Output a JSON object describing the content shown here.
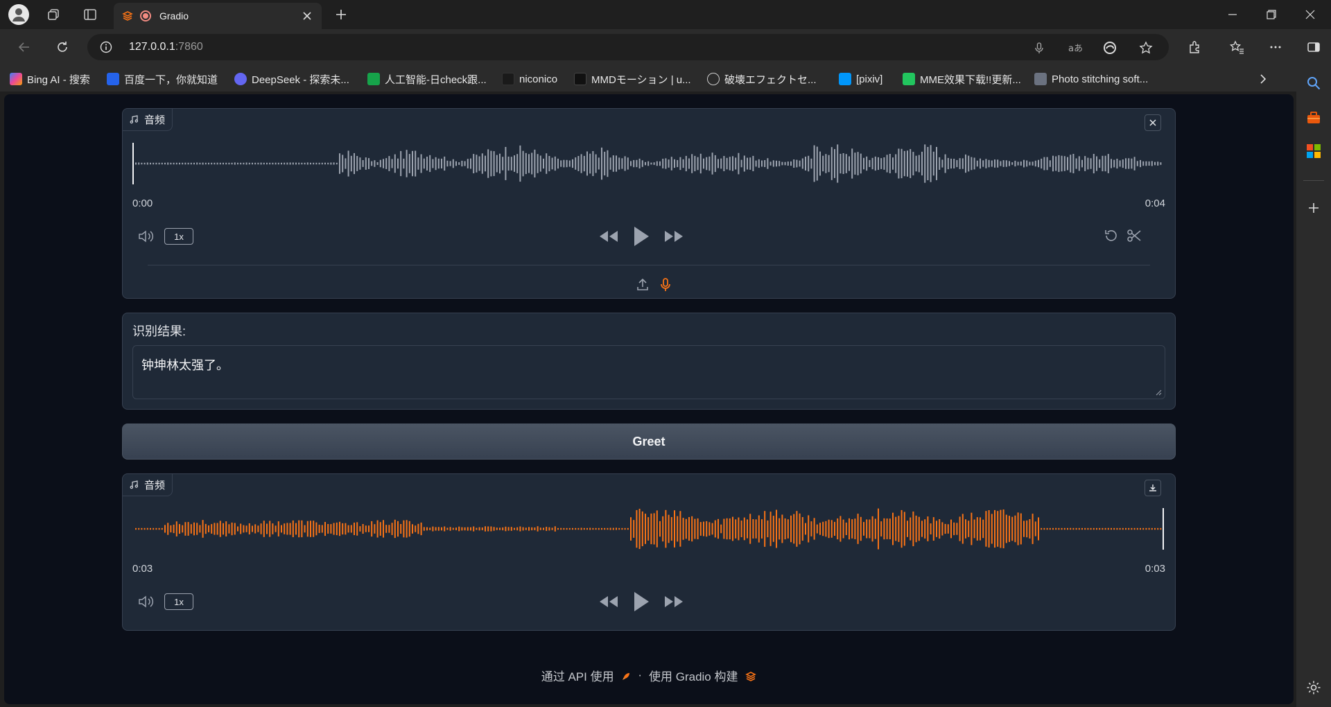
{
  "browser": {
    "tab": {
      "title": "Gradio"
    },
    "address": {
      "host": "127.0.0.1",
      "port": ":7860"
    },
    "bookmarks": [
      {
        "label": "Bing AI - 搜索",
        "color": "#3b82f6"
      },
      {
        "label": "百度一下，你就知道",
        "color": "#2563eb"
      },
      {
        "label": "DeepSeek - 探索未...",
        "color": "#6366f1"
      },
      {
        "label": "人工智能-日check跟...",
        "color": "#16a34a"
      },
      {
        "label": "niconico",
        "color": "#222222"
      },
      {
        "label": "MMDモーション | u...",
        "color": "#111111"
      },
      {
        "label": "破壊エフェクトセ...",
        "color": "#9ca3af"
      },
      {
        "label": "[pixiv]",
        "color": "#0096fa"
      },
      {
        "label": "MME效果下载!!更新...",
        "color": "#22c55e"
      },
      {
        "label": "Photo stitching soft...",
        "color": "#6b7280"
      }
    ]
  },
  "input_audio": {
    "label": "音频",
    "time_start": "0:00",
    "time_end": "0:04",
    "rate": "1x",
    "progress": 0,
    "wave_color": "#9ca3af"
  },
  "textbox": {
    "label": "识别结果:",
    "value": "钟坤林太强了。"
  },
  "greet_button": {
    "label": "Greet"
  },
  "output_audio": {
    "label": "音频",
    "time_start": "0:03",
    "time_end": "0:03",
    "rate": "1x",
    "progress": 1,
    "wave_color": "#f97316"
  },
  "footer": {
    "api_text": "通过 API 使用",
    "sep": "·",
    "built_text": "使用 Gradio 构建"
  },
  "colors": {
    "accent": "#f97316",
    "page_bg": "#0b0f19",
    "card_bg": "#1f2937"
  }
}
